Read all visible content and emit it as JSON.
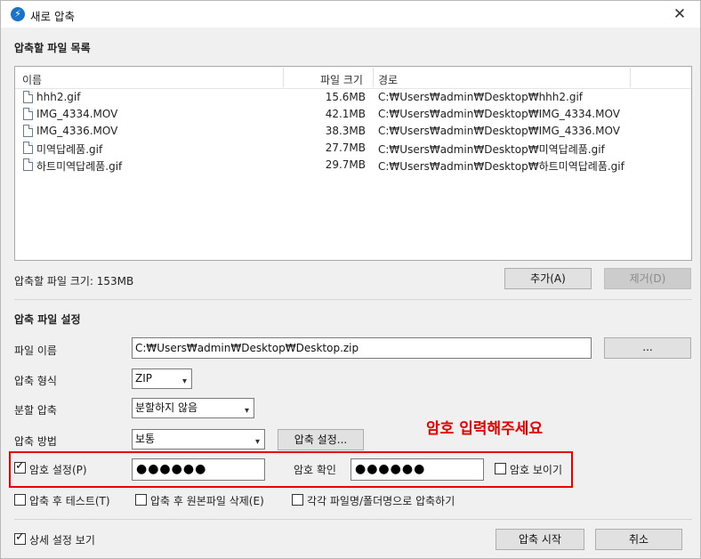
{
  "window": {
    "title": "새로 압축",
    "close_glyph": "✕"
  },
  "file_list": {
    "section_title": "압축할 파일 목록",
    "columns": [
      "이름",
      "파일 크기",
      "경로"
    ],
    "rows": [
      {
        "name": "hhh2.gif",
        "size": "15.6MB",
        "path": "C:₩Users₩admin₩Desktop₩hhh2.gif"
      },
      {
        "name": "IMG_4334.MOV",
        "size": "42.1MB",
        "path": "C:₩Users₩admin₩Desktop₩IMG_4334.MOV"
      },
      {
        "name": "IMG_4336.MOV",
        "size": "38.3MB",
        "path": "C:₩Users₩admin₩Desktop₩IMG_4336.MOV"
      },
      {
        "name": "미역답례품.gif",
        "size": "27.7MB",
        "path": "C:₩Users₩admin₩Desktop₩미역답례품.gif"
      },
      {
        "name": "하트미역답례품.gif",
        "size": "29.7MB",
        "path": "C:₩Users₩admin₩Desktop₩하트미역답례품.gif"
      }
    ],
    "total_size_label": "압축할 파일 크기: 153MB",
    "add_button": "추가(A)",
    "remove_button": "제거(D)"
  },
  "settings": {
    "section_title": "압축 파일 설정",
    "filename_label": "파일 이름",
    "filename_value": "C:₩Users₩admin₩Desktop₩Desktop.zip",
    "browse_button": "...",
    "format_label": "압축 형식",
    "format_value": "ZIP",
    "split_label": "분할 압축",
    "split_value": "분할하지 않음",
    "method_label": "압축 방법",
    "method_value": "보통",
    "method_settings_button": "압축 설정...",
    "annotation": "암호 입력해주세요",
    "password_checkbox_label": "암호 설정(P)",
    "password_value": "●●●●●●",
    "confirm_label": "암호 확인",
    "confirm_value": "●●●●●●",
    "show_password_label": "암호 보이기",
    "test_after_label": "압축 후 테스트(T)",
    "delete_original_label": "압축 후 원본파일 삭제(E)",
    "each_file_label": "각각 파일명/폴더명으로 압축하기"
  },
  "footer": {
    "advanced_label": "상세 설정 보기",
    "start_button": "압축 시작",
    "cancel_button": "취소"
  },
  "icons": {
    "app": "bandizip-app-icon",
    "file": "file-icon",
    "close": "close-icon",
    "dropdown": "chevron-down-icon",
    "check": "checkmark-icon"
  },
  "colors": {
    "accent_red": "#e60000",
    "app_icon_blue": "#1a73c8"
  },
  "checkbox_states": {
    "password": true,
    "show_password": false,
    "test_after": false,
    "delete_original": false,
    "each_file": false,
    "advanced": true
  }
}
